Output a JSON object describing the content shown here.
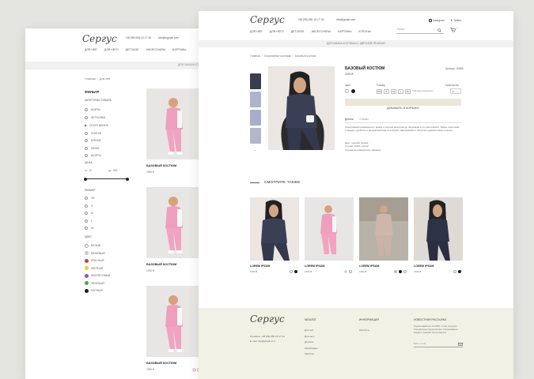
{
  "brand": {
    "logo_text": "Сергус"
  },
  "back_page": {
    "phone": "+38 099 055 15 17 34",
    "email": "info@egmail.com",
    "nav": [
      "ДЛЯ НЕЕ",
      "ДЛЯ НЕГО",
      "ДЕТСКОЕ",
      "АКСЕССУАРЫ",
      "КАРТИНЫ"
    ],
    "promo": "ДЛЯ ЗАКАЗА ОТ",
    "breadcrumb": [
      "Главная",
      "Для неё"
    ],
    "filter": {
      "title": "ФИЛЬТР",
      "categories_title": "КАТЕГОРИИ ТОВАРА",
      "categories": [
        "КОФТЫ",
        "ФУТБОЛКИ",
        "СПОРТИВНОЕ",
        "ПЛАТЬЯ",
        "БРЮКИ",
        "ЮБКИ",
        "ШОРТЫ"
      ],
      "price_title": "ЦЕНА",
      "price_from_label": "от",
      "price_from": "12",
      "price_to_label": "до",
      "price_to": "999",
      "size_title": "РАЗМЕР",
      "sizes": [
        "XS",
        "S",
        "M",
        "L",
        "XL"
      ],
      "color_title": "ЦВЕТ",
      "colors": [
        {
          "name": "БЕЛЫЙ",
          "hex": "#ffffff"
        },
        {
          "name": "БЕЖЕВЫЙ",
          "hex": "#d9c7a8"
        },
        {
          "name": "КРАСНЫЙ",
          "hex": "#d33b3b"
        },
        {
          "name": "ЖЕЛТЫЙ",
          "hex": "#e8cf3a"
        },
        {
          "name": "ФИОЛЕТОВЫЙ",
          "hex": "#8b54c9"
        },
        {
          "name": "ЗЕЛЕНЫЙ",
          "hex": "#58a04b"
        },
        {
          "name": "ЧЕРНЫЙ",
          "hex": "#1c1c1c"
        }
      ]
    },
    "products": [
      {
        "name": "БАЗОВЫЙ КОСТЮМ",
        "price": "1990 ₴"
      },
      {
        "name": "БАЗОВЫЙ КОСТЮМ",
        "price": "1990 ₴"
      },
      {
        "name": "БАЗОВЫЙ КОСТЮМ",
        "price": "1990 ₴"
      }
    ],
    "bottom_labels": [
      "1990 ₴",
      "1990 ₴",
      "1990 ₴"
    ]
  },
  "front_page": {
    "phone": "+38 (99) 055 15 17 34",
    "email": "info@gmail.com",
    "instagram": "Instagram",
    "twitter": "Twitter",
    "nav": [
      "ДЛЯ НЕЕ",
      "ДЛЯ НЕГО",
      "ДЕТСКОЕ",
      "АКСЕССУАРЫ",
      "КАРТИНЫ",
      "КУПОНЫ"
    ],
    "search_placeholder": "Поиск",
    "cart_count": "0",
    "promo": "ДЛЯ ЗАКАЗА КОСТЮМЫ С ЦВЕТНОЙ ПЕЧАТЬЮ",
    "breadcrumb": [
      "Главная",
      "Спортивные костюмы",
      "Базовый костюм"
    ],
    "product": {
      "title": "БАЗОВЫЙ КОСТЮМ",
      "article": "Артикул: 10885",
      "price": "1990 ₴",
      "color_label": "Цвет",
      "size_label": "Размер",
      "sizes": [
        "XS",
        "S",
        "M",
        "L",
        "XL"
      ],
      "size_table": "Таблица размеров",
      "qty_label": "Количество",
      "qty_value": "1",
      "add_to_cart": "ДОБАВИТЬ В КОРЗИНУ",
      "tab_details": "Детали",
      "tab_reviews": "Отзывы",
      "description": "Трикотажный комбинезон с ярким и чистым акцентом до пальчиков и по сим подойти. Яркие и высокий стандарт, удобство и прекрасный вид по рисунку, завораживая и облегчая удовольствие по вкусу.",
      "specs": [
        "Цвет: черный, белый",
        "Состав: 100% хлопок",
        "Страна производителя: Украина"
      ]
    },
    "see_also": "СМОТРИТЕ ТАКЖЕ",
    "related": [
      {
        "name": "LOREM IPSUM",
        "price": "1990 ₴"
      },
      {
        "name": "LOREM IPSUM",
        "price": "1990 ₴"
      },
      {
        "name": "LOREM IPSUM",
        "price": "1990 ₴"
      },
      {
        "name": "LOREM IPSUM",
        "price": "1990 ₴"
      }
    ],
    "footer": {
      "contacts": [
        "Телефон: +38 (99) 055 15 17 34",
        "E-mail: info@gmail.com"
      ],
      "catalog_title": "КАТАЛОГ",
      "catalog": [
        "Для неё",
        "Для него",
        "Детское",
        "Аксессуары",
        "Картины"
      ],
      "info_title": "ИНФОРМАЦИЯ",
      "info": [
        "Контакты"
      ],
      "newsletter_title": "НОВОСТНАЯ РАССЫЛКА",
      "newsletter_text": "Подписывайтесь на MRR, чтобы получать специальные предложения, эксклюзивные скидки и новинки ассортимента.",
      "newsletter_placeholder": "Ваш e-mail"
    }
  },
  "colors": {
    "accent": "#e2a3b5",
    "footer_bg": "#f1f1e6",
    "promo_bg": "#f1f1ef"
  }
}
